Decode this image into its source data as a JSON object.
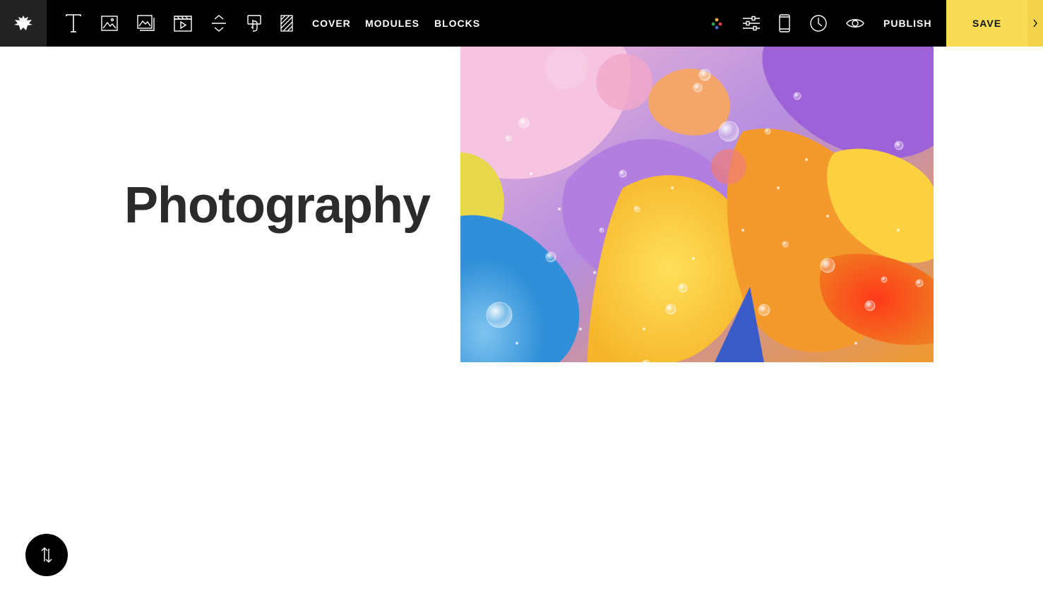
{
  "toolbar": {
    "logo_icon": "eagle-logo-icon",
    "tools": [
      {
        "name": "text-tool-icon"
      },
      {
        "name": "image-tool-icon"
      },
      {
        "name": "gallery-tool-icon"
      },
      {
        "name": "video-tool-icon"
      },
      {
        "name": "spacer-tool-icon"
      },
      {
        "name": "button-tool-icon"
      },
      {
        "name": "grid-tool-icon"
      }
    ],
    "nav": {
      "cover": "COVER",
      "modules": "MODULES",
      "blocks": "BLOCKS"
    },
    "right_icons": [
      {
        "name": "palette-icon"
      },
      {
        "name": "settings-sliders-icon"
      },
      {
        "name": "mobile-preview-icon"
      },
      {
        "name": "history-clock-icon"
      },
      {
        "name": "preview-eye-icon"
      }
    ],
    "publish_label": "PUBLISH",
    "save_label": "SAVE",
    "accent_color": "#f8dc55"
  },
  "content": {
    "title": "Photography",
    "image_description_icon": "abstract-oil-bubbles-image"
  },
  "scroll_button": {
    "icon": "reorder-arrows-icon"
  }
}
